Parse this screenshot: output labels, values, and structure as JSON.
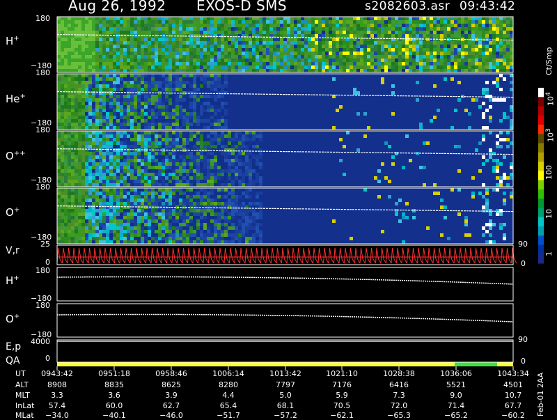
{
  "header": {
    "date": "Aug 26, 1992",
    "instrument": "EXOS-D SMS",
    "file": "s2082603.asr",
    "time": "09:43:42"
  },
  "panels": [
    {
      "species": "H",
      "charge": "+",
      "ymax": "180",
      "ymin": "−180"
    },
    {
      "species": "He",
      "charge": "+",
      "ymax": "180",
      "ymin": "−180"
    },
    {
      "species": "O",
      "charge": "++",
      "ymax": "180",
      "ymin": "−180"
    },
    {
      "species": "O",
      "charge": "+",
      "ymax": "180",
      "ymin": "−180"
    }
  ],
  "vr_panel": {
    "label": "V,r",
    "left_top": "25",
    "left_bottom": "0",
    "right_top": "90",
    "right_bottom": "0"
  },
  "line_panels": [
    {
      "species": "H",
      "charge": "+",
      "ymax": "180",
      "ymin": "−180"
    },
    {
      "species": "O",
      "charge": "+",
      "ymax": "180",
      "ymin": "−180"
    }
  ],
  "ep_panel": {
    "label": "E,p",
    "left_top": "4000",
    "right_top": "90"
  },
  "qa_panel": {
    "label": "QA",
    "left_bottom": "0",
    "right_bottom": "0"
  },
  "colorbar": {
    "unit": "Ct/Smp",
    "ticks": [
      {
        "base": "10",
        "exp": "4"
      },
      {
        "base": "10",
        "exp": "3"
      },
      {
        "base": "100",
        "exp": ""
      },
      {
        "base": "10",
        "exp": ""
      },
      {
        "base": "1",
        "exp": ""
      }
    ],
    "colors": [
      "#ffffff",
      "#7a0000",
      "#b30000",
      "#e00000",
      "#ff2a00",
      "#5a4a00",
      "#8a7a00",
      "#b0a000",
      "#d8d000",
      "#ffff00",
      "#7ad000",
      "#30c000",
      "#009a30",
      "#00a070",
      "#00c8c8",
      "#00a0b0",
      "#0050c8",
      "#0030a0",
      "#1a2a88"
    ]
  },
  "chart_data": {
    "type": "heatmap",
    "x_axis": "UT",
    "rows": [
      "UT",
      "ALT",
      "MLT",
      "InLat",
      "MLat"
    ],
    "columns": [
      [
        "0943:42",
        "8908",
        "3.3",
        "57.4",
        "−34.0"
      ],
      [
        "0951:18",
        "8835",
        "3.6",
        "60.0",
        "−40.1"
      ],
      [
        "0958:46",
        "8625",
        "3.9",
        "62.7",
        "−46.0"
      ],
      [
        "1006:14",
        "8280",
        "4.4",
        "65.4",
        "−51.7"
      ],
      [
        "1013:42",
        "7797",
        "5.0",
        "68.1",
        "−57.2"
      ],
      [
        "1021:10",
        "7176",
        "5.9",
        "70.5",
        "−62.1"
      ],
      [
        "1028:38",
        "6416",
        "7.3",
        "72.0",
        "−65.3"
      ],
      [
        "1036:06",
        "5521",
        "9.0",
        "71.4",
        "−65.2"
      ],
      [
        "1043:34",
        "4501",
        "10.7",
        "67.7",
        "−60.2"
      ]
    ],
    "pitch_angle_range": [
      -180,
      180
    ],
    "colorscale": "log",
    "color_range": [
      1,
      10000
    ]
  },
  "footer_note": "Feb-01 2AA"
}
